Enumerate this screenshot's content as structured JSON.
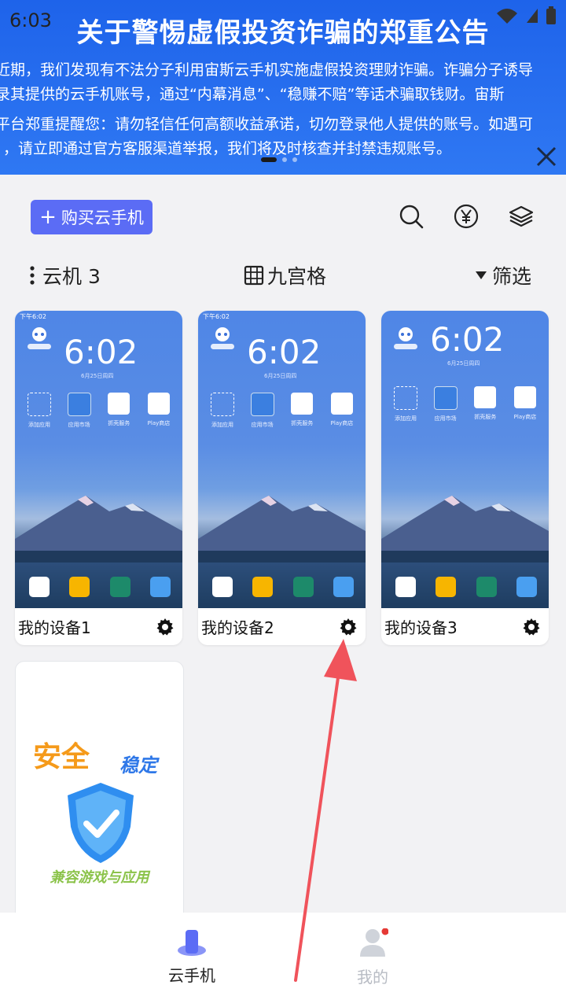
{
  "status_bar": {
    "time": "6:03"
  },
  "banner": {
    "title": "关于警惕虚假投资诈骗的郑重公告",
    "lines": [
      "近期，我们发现有不法分子利用宙斯云手机实施虚假投资理财诈骗。诈骗分子诱导",
      "录其提供的云手机账号，通过“内幕消息”、“稳赚不赔”等话术骗取钱财。宙斯",
      "平台郑重提醒您：请勿轻信任何高额收益承诺，切勿登录他人提供的账号。如遇可",
      "，请立即通过官方客服渠道举报，我们将及时核查并封禁违规账号。"
    ],
    "page_indicator": {
      "count": 3,
      "active": 0
    }
  },
  "toolbar": {
    "buy_label": "购买云手机",
    "search_icon": "search-icon",
    "yuan_icon": "yuan-icon",
    "layers_icon": "layers-icon"
  },
  "filter_bar": {
    "group_label": "云机 3",
    "grid_label": "九宫格",
    "filter_label": "筛选"
  },
  "devices": [
    {
      "name": "我的设备1",
      "status_time": "下午6:02",
      "clock": "6:02",
      "date": "6月25日周四"
    },
    {
      "name": "我的设备2",
      "status_time": "下午6:02",
      "clock": "6:02",
      "date": "6月25日周四"
    },
    {
      "name": "我的设备3",
      "status_time": "",
      "clock": "6:02",
      "date": "6月25日周四"
    }
  ],
  "device_apps": [
    "添加应用",
    "应用市场",
    "抓壳服务",
    "Play商店"
  ],
  "promo": {
    "word1": "安全",
    "word2": "稳定",
    "caption": "兼容游戏与应用"
  },
  "bottom_nav": {
    "items": [
      {
        "label": "云手机",
        "active": true
      },
      {
        "label": "我的",
        "active": false,
        "badge": true
      }
    ]
  },
  "colors": {
    "accent": "#5b6cf5",
    "banner_blue": "#2468ec",
    "badge_red": "#e53935",
    "arrow_red": "#f0535b"
  }
}
